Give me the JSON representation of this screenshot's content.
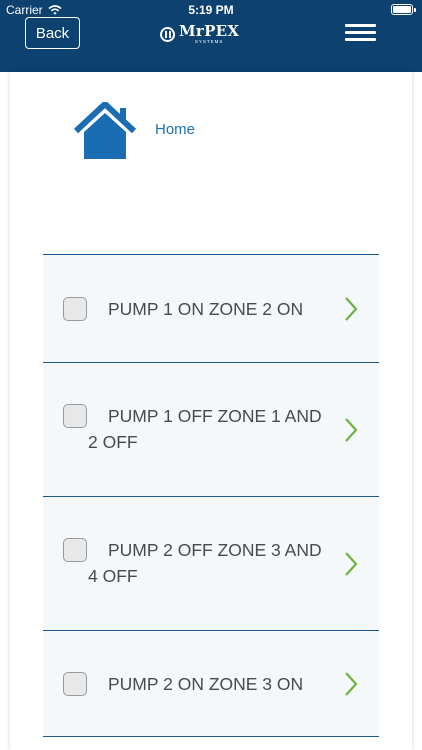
{
  "status_bar": {
    "carrier": "Carrier",
    "time": "5:19 PM"
  },
  "header": {
    "back_label": "Back",
    "logo_name": "MrPEX",
    "logo_sub": "SYSTEMS",
    "menu_icon": "hamburger-menu-icon"
  },
  "home": {
    "icon": "house-icon",
    "label": "Home"
  },
  "items": [
    {
      "label": "PUMP 1 ON ZONE 2 ON",
      "checked": false
    },
    {
      "label": "PUMP 1 OFF ZONE 1 AND 2 OFF",
      "checked": false
    },
    {
      "label": "PUMP 2 OFF ZONE 3 AND 4 OFF",
      "checked": false
    },
    {
      "label": "PUMP 2 ON ZONE 3 ON",
      "checked": false
    }
  ],
  "colors": {
    "header": "#0c4170",
    "link": "#1a73b8",
    "chevron": "#6cb33f",
    "row_background": "#f4f8fb"
  }
}
